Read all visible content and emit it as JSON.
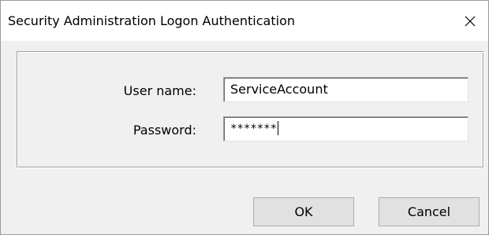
{
  "window": {
    "title": "Security Administration Logon Authentication",
    "close_icon": "close-icon"
  },
  "form": {
    "username_label": "User name:",
    "username_value": "ServiceAccount",
    "password_label": "Password:",
    "password_value": "*******"
  },
  "buttons": {
    "ok_label": "OK",
    "cancel_label": "Cancel"
  }
}
